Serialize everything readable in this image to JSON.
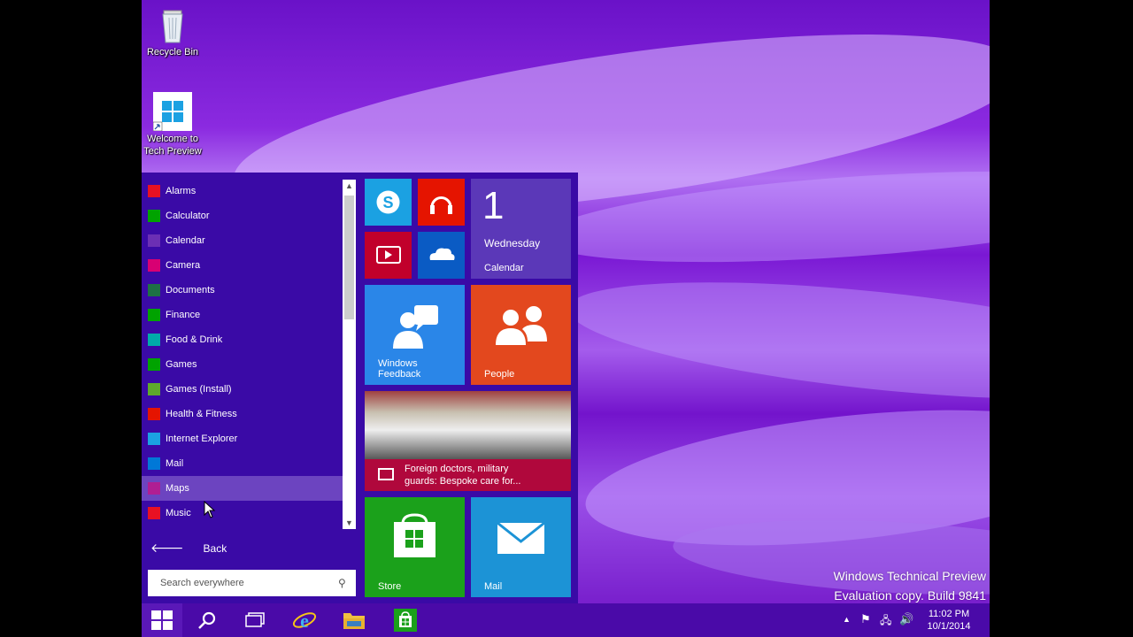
{
  "desktop": {
    "icons": [
      {
        "label": "Recycle Bin",
        "icon": "recycle-bin-icon"
      },
      {
        "label": "Welcome to Tech Preview",
        "icon": "windows-logo-icon"
      }
    ],
    "watermark": {
      "line1": "Windows Technical Preview",
      "line2": "Evaluation copy. Build 9841"
    }
  },
  "start_menu": {
    "apps": [
      {
        "label": "Alarms",
        "icon": "alarm-icon",
        "color": "#e81123"
      },
      {
        "label": "Calculator",
        "icon": "calculator-icon",
        "color": "#00a300"
      },
      {
        "label": "Calendar",
        "icon": "calendar-icon",
        "color": "#6b2fb4"
      },
      {
        "label": "Camera",
        "icon": "camera-icon",
        "color": "#d80073"
      },
      {
        "label": "Documents",
        "icon": "documents-icon",
        "color": "#1e7145"
      },
      {
        "label": "Finance",
        "icon": "finance-icon",
        "color": "#00a300"
      },
      {
        "label": "Food & Drink",
        "icon": "food-drink-icon",
        "color": "#00aba9"
      },
      {
        "label": "Games",
        "icon": "games-icon",
        "color": "#00a300"
      },
      {
        "label": "Games (Install)",
        "icon": "games-install-icon",
        "color": "#5ea92c"
      },
      {
        "label": "Health & Fitness",
        "icon": "health-icon",
        "color": "#e51400"
      },
      {
        "label": "Internet Explorer",
        "icon": "internet-explorer-icon",
        "color": "#1ba1e2"
      },
      {
        "label": "Mail",
        "icon": "mail-icon",
        "color": "#0078d7"
      },
      {
        "label": "Maps",
        "icon": "maps-icon",
        "color": "#b01e93"
      },
      {
        "label": "Music",
        "icon": "music-icon",
        "color": "#e81123"
      }
    ],
    "selected_index": 12,
    "back_label": "Back",
    "search_placeholder": "Search everywhere",
    "tiles": {
      "calendar": {
        "day": "1",
        "weekday": "Wednesday",
        "label": "Calendar"
      },
      "feedback": {
        "label_line1": "Windows",
        "label_line2": "Feedback"
      },
      "people": {
        "label": "People"
      },
      "news": {
        "headline_line1": "Foreign doctors, military",
        "headline_line2": "guards: Bespoke care for..."
      },
      "store": {
        "label": "Store"
      },
      "mail": {
        "label": "Mail"
      }
    }
  },
  "tray": {
    "time": "11:02 PM",
    "date": "10/1/2014"
  },
  "colors": {
    "start_bg": "#3a0aa6",
    "skype": "#1ba1e2",
    "music": "#e51400",
    "video": "#c1002b",
    "onedrive": "#0a5bc4",
    "calendar": "#5b38b8",
    "feedback": "#2a86e8",
    "people": "#e3481e",
    "store": "#1ba11b",
    "mail": "#1c93d6"
  }
}
